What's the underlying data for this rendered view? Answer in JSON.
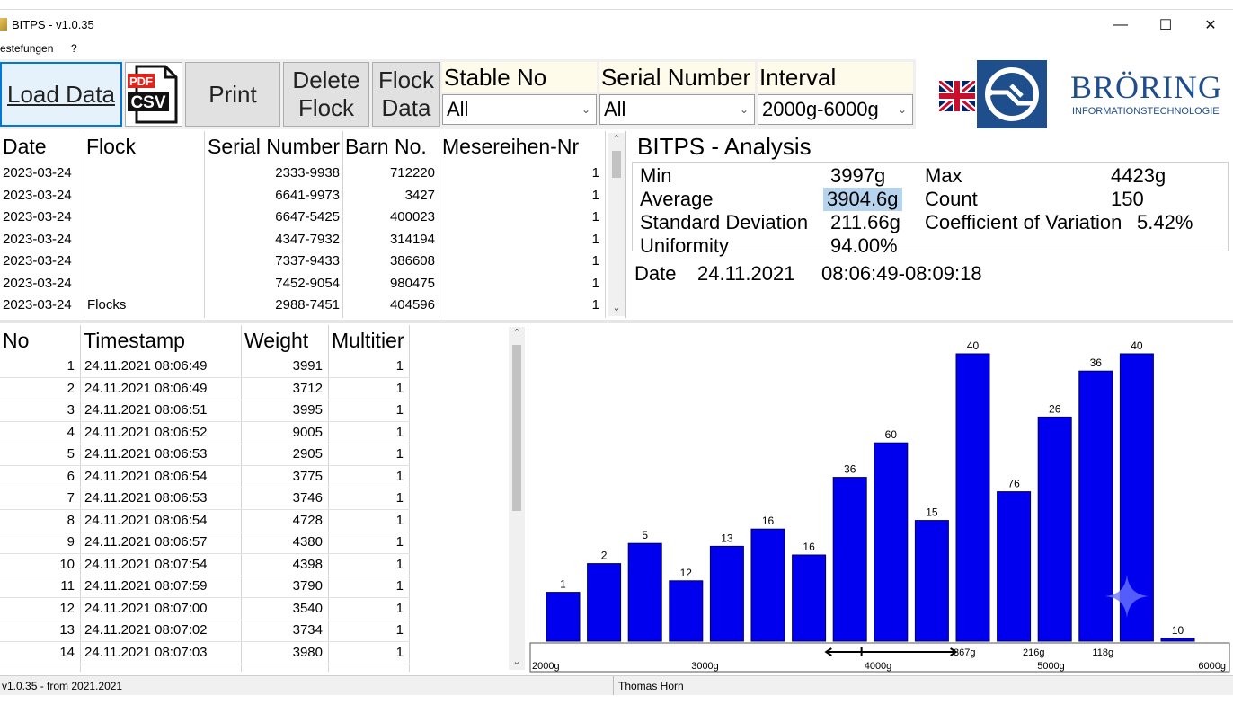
{
  "window": {
    "title": "BITPS - v1.0.35",
    "minimize": "—",
    "maximize": "☐",
    "close": "✕"
  },
  "menu": {
    "item1": "estefungen",
    "item2": "?"
  },
  "toolbar": {
    "load": "Load Data",
    "csv_pdf_top": "PDF",
    "csv_pdf_bottom": "CSV",
    "print": "Print",
    "delete_line1": "Delete",
    "delete_line2": "Flock",
    "flock_line1": "Flock",
    "flock_line2": "Data",
    "stable_label": "Stable No",
    "stable_value": "All",
    "serial_label": "Serial Number",
    "serial_value": "All",
    "interval_label": "Interval",
    "interval_value": "2000g-6000g"
  },
  "logo": {
    "brand": "BRÖRING",
    "tagline": "INFORMATIONSTECHNOLOGIE"
  },
  "flock_table": {
    "headers": [
      "Date",
      "Flock",
      "Serial Number",
      "Barn No.",
      "Mesereihen-Nr"
    ],
    "rows": [
      [
        "2023-03-24",
        "",
        "2333-9938",
        "712220",
        "1"
      ],
      [
        "2023-03-24",
        "",
        "6641-9973",
        "3427",
        "1"
      ],
      [
        "2023-03-24",
        "",
        "6647-5425",
        "400023",
        "1"
      ],
      [
        "2023-03-24",
        "",
        "4347-7932",
        "314194",
        "1"
      ],
      [
        "2023-03-24",
        "",
        "7337-9433",
        "386608",
        "1"
      ],
      [
        "2023-03-24",
        "",
        "7452-9054",
        "980475",
        "1"
      ],
      [
        "2023-03-24",
        "Flocks",
        "2988-7451",
        "404596",
        "1"
      ]
    ]
  },
  "analysis": {
    "title": "BITPS - Analysis",
    "min_label": "Min",
    "min_value": "3997g",
    "max_label": "Max",
    "max_value": "4423g",
    "avg_label": "Average",
    "avg_value": "3904.6g",
    "count_label": "Count",
    "count_value": "150",
    "sd_label": "Standard Deviation",
    "sd_value": "211.66g",
    "cv_label": "Coefficient of Variation",
    "cv_value": "5.42%",
    "uni_label": "Uniformity",
    "uni_value": "94.00%",
    "date_label": "Date",
    "date_value": "24.11.2021",
    "time_value": "08:06:49-08:09:18"
  },
  "weights_table": {
    "headers": [
      "No",
      "Timestamp",
      "Weight",
      "Multitier"
    ],
    "rows": [
      [
        "1",
        "24.11.2021 08:06:49",
        "3991",
        "1"
      ],
      [
        "2",
        "24.11.2021 08:06:49",
        "3712",
        "1"
      ],
      [
        "3",
        "24.11.2021 08:06:51",
        "3995",
        "1"
      ],
      [
        "4",
        "24.11.2021 08:06:52",
        "9005",
        "1"
      ],
      [
        "5",
        "24.11.2021 08:06:53",
        "2905",
        "1"
      ],
      [
        "6",
        "24.11.2021 08:06:54",
        "3775",
        "1"
      ],
      [
        "7",
        "24.11.2021 08:06:53",
        "3746",
        "1"
      ],
      [
        "8",
        "24.11.2021 08:06:54",
        "4728",
        "1"
      ],
      [
        "9",
        "24.11.2021 08:06:57",
        "4380",
        "1"
      ],
      [
        "10",
        "24.11.2021 08:07:54",
        "4398",
        "1"
      ],
      [
        "11",
        "24.11.2021 08:07:59",
        "3790",
        "1"
      ],
      [
        "12",
        "24.11.2021 08:07:00",
        "3540",
        "1"
      ],
      [
        "13",
        "24.11.2021 08:07:02",
        "3734",
        "1"
      ],
      [
        "14",
        "24.11.2021 08:07:03",
        "3980",
        "1"
      ]
    ]
  },
  "chart_data": {
    "type": "bar",
    "values": [
      1,
      2,
      5,
      12,
      13,
      16,
      16,
      36,
      60,
      15,
      40,
      76,
      26,
      36,
      40,
      10
    ],
    "value_labels": [
      "1",
      "2",
      "5",
      "12",
      "13",
      "16",
      "16",
      "36",
      "60",
      "15",
      "40",
      "76",
      "26",
      "36",
      "40",
      "10"
    ],
    "relative_heights": [
      0.17,
      0.27,
      0.34,
      0.21,
      0.33,
      0.39,
      0.3,
      0.57,
      0.69,
      0.42,
      1.0,
      0.52,
      0.78,
      0.94,
      1.0,
      0.01
    ],
    "bar_color": "#0000ee",
    "x_tick_labels": [
      "2000g",
      "3000g",
      "4000g",
      "5000g",
      "6000g"
    ],
    "x_range": [
      2000,
      6000
    ],
    "upper_axis_labels": [
      "367g",
      "216g",
      "118g"
    ],
    "upper_axis_label_positions_g": [
      4500,
      4900,
      5300
    ],
    "uniformity_range_g": [
      3700,
      4450
    ],
    "uniformity_center_g": [
      3904.6
    ]
  },
  "status": {
    "left": "v1.0.35 - from 2021.2021",
    "user": "Thomas Horn"
  },
  "colors": {
    "accent": "#0078d7",
    "bar": "#0000ee",
    "logo_blue": "#1f4e8c",
    "highlight": "#b7d4ef"
  }
}
